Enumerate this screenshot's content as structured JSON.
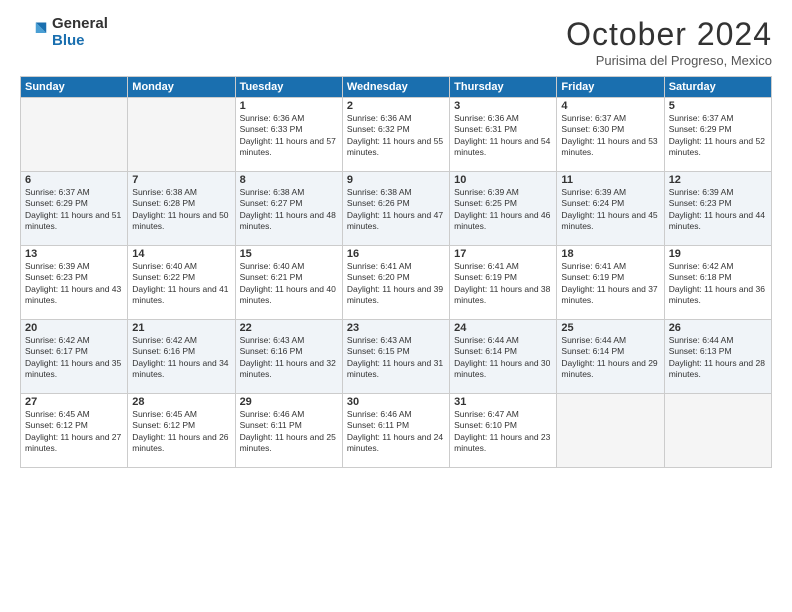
{
  "header": {
    "logo": {
      "general": "General",
      "blue": "Blue"
    },
    "title": "October 2024",
    "location": "Purisima del Progreso, Mexico"
  },
  "weekdays": [
    "Sunday",
    "Monday",
    "Tuesday",
    "Wednesday",
    "Thursday",
    "Friday",
    "Saturday"
  ],
  "weeks": [
    [
      {
        "day": "",
        "info": ""
      },
      {
        "day": "",
        "info": ""
      },
      {
        "day": "1",
        "info": "Sunrise: 6:36 AM\nSunset: 6:33 PM\nDaylight: 11 hours and 57 minutes."
      },
      {
        "day": "2",
        "info": "Sunrise: 6:36 AM\nSunset: 6:32 PM\nDaylight: 11 hours and 55 minutes."
      },
      {
        "day": "3",
        "info": "Sunrise: 6:36 AM\nSunset: 6:31 PM\nDaylight: 11 hours and 54 minutes."
      },
      {
        "day": "4",
        "info": "Sunrise: 6:37 AM\nSunset: 6:30 PM\nDaylight: 11 hours and 53 minutes."
      },
      {
        "day": "5",
        "info": "Sunrise: 6:37 AM\nSunset: 6:29 PM\nDaylight: 11 hours and 52 minutes."
      }
    ],
    [
      {
        "day": "6",
        "info": "Sunrise: 6:37 AM\nSunset: 6:29 PM\nDaylight: 11 hours and 51 minutes."
      },
      {
        "day": "7",
        "info": "Sunrise: 6:38 AM\nSunset: 6:28 PM\nDaylight: 11 hours and 50 minutes."
      },
      {
        "day": "8",
        "info": "Sunrise: 6:38 AM\nSunset: 6:27 PM\nDaylight: 11 hours and 48 minutes."
      },
      {
        "day": "9",
        "info": "Sunrise: 6:38 AM\nSunset: 6:26 PM\nDaylight: 11 hours and 47 minutes."
      },
      {
        "day": "10",
        "info": "Sunrise: 6:39 AM\nSunset: 6:25 PM\nDaylight: 11 hours and 46 minutes."
      },
      {
        "day": "11",
        "info": "Sunrise: 6:39 AM\nSunset: 6:24 PM\nDaylight: 11 hours and 45 minutes."
      },
      {
        "day": "12",
        "info": "Sunrise: 6:39 AM\nSunset: 6:23 PM\nDaylight: 11 hours and 44 minutes."
      }
    ],
    [
      {
        "day": "13",
        "info": "Sunrise: 6:39 AM\nSunset: 6:23 PM\nDaylight: 11 hours and 43 minutes."
      },
      {
        "day": "14",
        "info": "Sunrise: 6:40 AM\nSunset: 6:22 PM\nDaylight: 11 hours and 41 minutes."
      },
      {
        "day": "15",
        "info": "Sunrise: 6:40 AM\nSunset: 6:21 PM\nDaylight: 11 hours and 40 minutes."
      },
      {
        "day": "16",
        "info": "Sunrise: 6:41 AM\nSunset: 6:20 PM\nDaylight: 11 hours and 39 minutes."
      },
      {
        "day": "17",
        "info": "Sunrise: 6:41 AM\nSunset: 6:19 PM\nDaylight: 11 hours and 38 minutes."
      },
      {
        "day": "18",
        "info": "Sunrise: 6:41 AM\nSunset: 6:19 PM\nDaylight: 11 hours and 37 minutes."
      },
      {
        "day": "19",
        "info": "Sunrise: 6:42 AM\nSunset: 6:18 PM\nDaylight: 11 hours and 36 minutes."
      }
    ],
    [
      {
        "day": "20",
        "info": "Sunrise: 6:42 AM\nSunset: 6:17 PM\nDaylight: 11 hours and 35 minutes."
      },
      {
        "day": "21",
        "info": "Sunrise: 6:42 AM\nSunset: 6:16 PM\nDaylight: 11 hours and 34 minutes."
      },
      {
        "day": "22",
        "info": "Sunrise: 6:43 AM\nSunset: 6:16 PM\nDaylight: 11 hours and 32 minutes."
      },
      {
        "day": "23",
        "info": "Sunrise: 6:43 AM\nSunset: 6:15 PM\nDaylight: 11 hours and 31 minutes."
      },
      {
        "day": "24",
        "info": "Sunrise: 6:44 AM\nSunset: 6:14 PM\nDaylight: 11 hours and 30 minutes."
      },
      {
        "day": "25",
        "info": "Sunrise: 6:44 AM\nSunset: 6:14 PM\nDaylight: 11 hours and 29 minutes."
      },
      {
        "day": "26",
        "info": "Sunrise: 6:44 AM\nSunset: 6:13 PM\nDaylight: 11 hours and 28 minutes."
      }
    ],
    [
      {
        "day": "27",
        "info": "Sunrise: 6:45 AM\nSunset: 6:12 PM\nDaylight: 11 hours and 27 minutes."
      },
      {
        "day": "28",
        "info": "Sunrise: 6:45 AM\nSunset: 6:12 PM\nDaylight: 11 hours and 26 minutes."
      },
      {
        "day": "29",
        "info": "Sunrise: 6:46 AM\nSunset: 6:11 PM\nDaylight: 11 hours and 25 minutes."
      },
      {
        "day": "30",
        "info": "Sunrise: 6:46 AM\nSunset: 6:11 PM\nDaylight: 11 hours and 24 minutes."
      },
      {
        "day": "31",
        "info": "Sunrise: 6:47 AM\nSunset: 6:10 PM\nDaylight: 11 hours and 23 minutes."
      },
      {
        "day": "",
        "info": ""
      },
      {
        "day": "",
        "info": ""
      }
    ]
  ]
}
